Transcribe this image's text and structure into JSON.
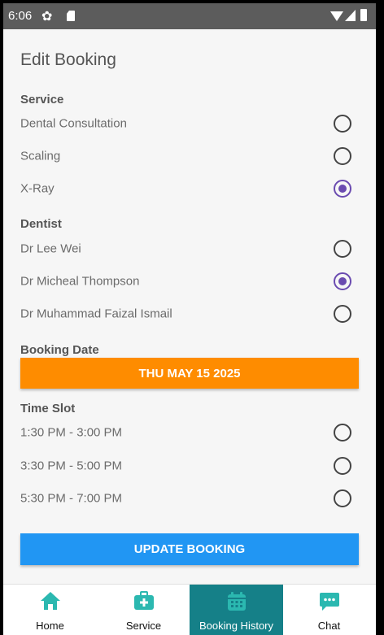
{
  "status_bar": {
    "time": "6:06"
  },
  "page": {
    "title": "Edit Booking"
  },
  "service": {
    "label": "Service",
    "options": [
      {
        "label": "Dental Consultation",
        "selected": false
      },
      {
        "label": "Scaling",
        "selected": false
      },
      {
        "label": "X-Ray",
        "selected": true
      }
    ]
  },
  "dentist": {
    "label": "Dentist",
    "options": [
      {
        "label": "Dr Lee Wei",
        "selected": false
      },
      {
        "label": "Dr Micheal Thompson",
        "selected": true
      },
      {
        "label": "Dr Muhammad Faizal Ismail",
        "selected": false
      }
    ]
  },
  "booking_date": {
    "label": "Booking Date",
    "value": "THU MAY 15 2025"
  },
  "time_slot": {
    "label": "Time Slot",
    "options": [
      {
        "label": "1:30 PM - 3:00 PM",
        "selected": false
      },
      {
        "label": "3:30 PM - 5:00 PM",
        "selected": false
      },
      {
        "label": "5:30 PM - 7:00 PM",
        "selected": false
      }
    ]
  },
  "actions": {
    "update_label": "UPDATE BOOKING"
  },
  "nav": {
    "items": [
      {
        "label": "Home",
        "icon": "home-icon",
        "active": false
      },
      {
        "label": "Service",
        "icon": "medical-kit-icon",
        "active": false
      },
      {
        "label": "Booking History",
        "icon": "calendar-icon",
        "active": true
      },
      {
        "label": "Chat",
        "icon": "chat-icon",
        "active": false
      }
    ]
  },
  "colors": {
    "accent_radio": "#6a4bb0",
    "date_button": "#fe8c00",
    "update_button": "#2196f3",
    "nav_active": "#158088",
    "nav_icon": "#2bb8b0"
  }
}
